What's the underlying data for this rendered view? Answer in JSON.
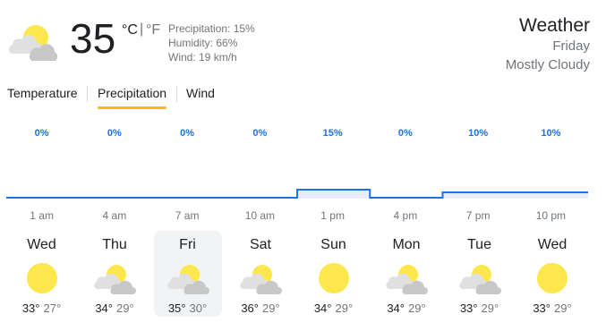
{
  "current": {
    "temperature": "35",
    "unit_c": "°C",
    "unit_sep": "|",
    "unit_f": "°F",
    "precipitation": "Precipitation: 15%",
    "humidity": "Humidity: 66%",
    "wind": "Wind: 19 km/h",
    "icon": "partly-cloudy-icon"
  },
  "header": {
    "title": "Weather",
    "day": "Friday",
    "condition": "Mostly Cloudy"
  },
  "tabs": [
    {
      "label": "Temperature",
      "active": false
    },
    {
      "label": "Precipitation",
      "active": true
    },
    {
      "label": "Wind",
      "active": false
    }
  ],
  "chart_data": {
    "type": "area",
    "x": [
      "1 am",
      "4 am",
      "7 am",
      "10 am",
      "1 pm",
      "4 pm",
      "7 pm",
      "10 pm"
    ],
    "series": [
      {
        "values": [
          0,
          0,
          0,
          0,
          15,
          0,
          10,
          10
        ]
      }
    ],
    "labels": [
      "0%",
      "0%",
      "0%",
      "0%",
      "15%",
      "0%",
      "10%",
      "10%"
    ],
    "line_color": "#1a73e8"
  },
  "forecast": [
    {
      "day": "Wed",
      "icon": "sunny-icon",
      "high": "33°",
      "low": "27°"
    },
    {
      "day": "Thu",
      "icon": "partly-cloudy-icon",
      "high": "34°",
      "low": "29°"
    },
    {
      "day": "Fri",
      "icon": "partly-cloudy-icon",
      "high": "35°",
      "low": "30°",
      "selected": true
    },
    {
      "day": "Sat",
      "icon": "partly-cloudy-icon",
      "high": "36°",
      "low": "29°"
    },
    {
      "day": "Sun",
      "icon": "sunny-icon",
      "high": "34°",
      "low": "29°"
    },
    {
      "day": "Mon",
      "icon": "partly-cloudy-icon",
      "high": "34°",
      "low": "29°"
    },
    {
      "day": "Tue",
      "icon": "partly-cloudy-icon",
      "high": "33°",
      "low": "29°"
    },
    {
      "day": "Wed",
      "icon": "sunny-icon",
      "high": "33°",
      "low": "29°"
    }
  ]
}
